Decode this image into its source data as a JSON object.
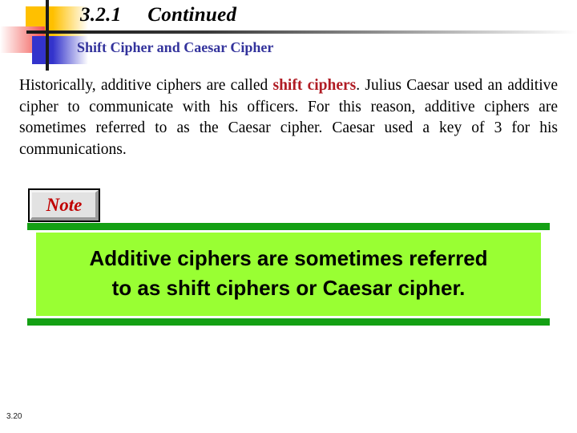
{
  "slide": {
    "title": "3.2.1     Continued",
    "subtitle": "Shift Cipher and Caesar Cipher",
    "body": {
      "segment_1": "Historically, additive ciphers are called ",
      "highlight": "shift ciphers",
      "segment_2": ". Julius Caesar used an additive cipher to communicate with his officers. For this reason, additive ciphers are sometimes referred to as the Caesar cipher. Caesar used a key of 3 for his communications."
    },
    "note": {
      "label": "Note"
    },
    "callout": {
      "line_1": "Additive ciphers are sometimes referred",
      "line_2": "to as shift ciphers or Caesar cipher."
    },
    "footer": {
      "page_number": "3.20"
    }
  },
  "colors": {
    "title_text": "#000000",
    "subtitle_text": "#33339c",
    "highlight_text": "#b01c24",
    "note_text": "#c00000",
    "callout_fill": "#99ff33",
    "callout_bar": "#14a014",
    "logo_yellow": "#ffc000",
    "logo_red": "#f2524e",
    "logo_blue": "#3333cc"
  }
}
